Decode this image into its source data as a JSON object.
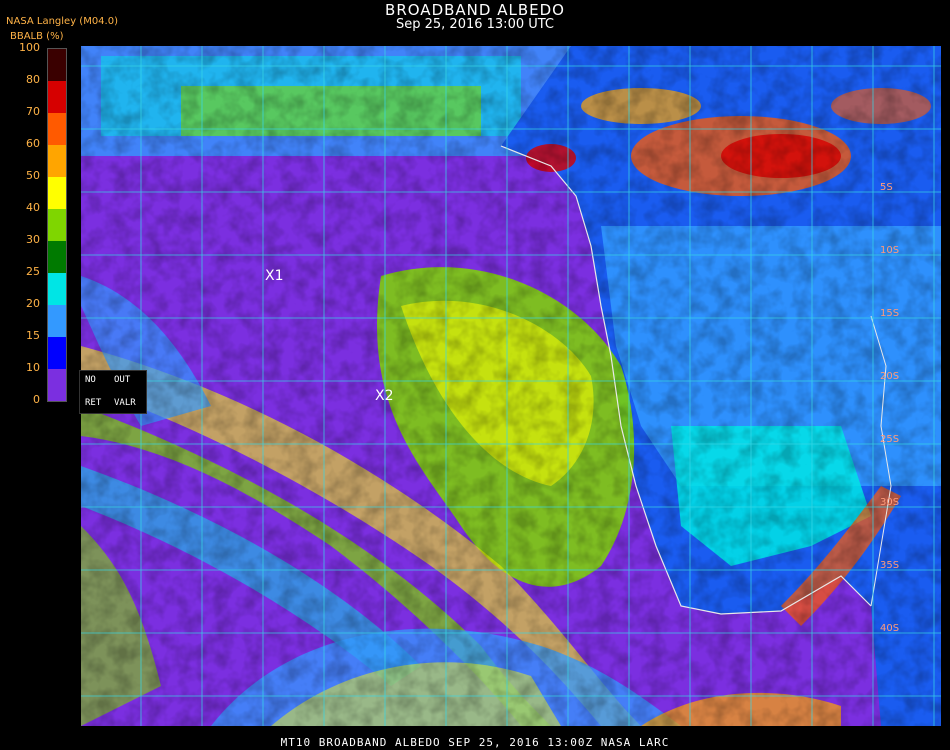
{
  "header": {
    "title": "BROADBAND ALBEDO",
    "datetime": "Sep 25, 2016 13:00 UTC",
    "source": "NASA Langley (M04.0)",
    "unit_label": "BBALB (%)"
  },
  "colorbar": {
    "ticks": [
      "100",
      "80",
      "70",
      "60",
      "50",
      "40",
      "30",
      "25",
      "20",
      "15",
      "10",
      "0"
    ],
    "colors": [
      "#3a0000",
      "#d60000",
      "#ff5a00",
      "#ffa500",
      "#ffff00",
      "#7fd600",
      "#007a00",
      "#00e5e5",
      "#3399ff",
      "#0000ff",
      "#7b2fe0"
    ]
  },
  "legend_box": {
    "no": "NO",
    "out": "OUT",
    "ret": "RET",
    "valr": "VALR"
  },
  "markers": [
    {
      "label": "X1"
    },
    {
      "label": "X2"
    }
  ],
  "lat_labels": [
    "5S",
    "10S",
    "15S",
    "20S",
    "25S",
    "30S",
    "35S",
    "40S"
  ],
  "footer": "MT10  BROADBAND ALBEDO   SEP 25, 2016 13:00Z   NASA LARC",
  "colors": {
    "ocean": "#7b2fe0",
    "grid": "#37d7e6",
    "coast": "#e8e8e8"
  }
}
